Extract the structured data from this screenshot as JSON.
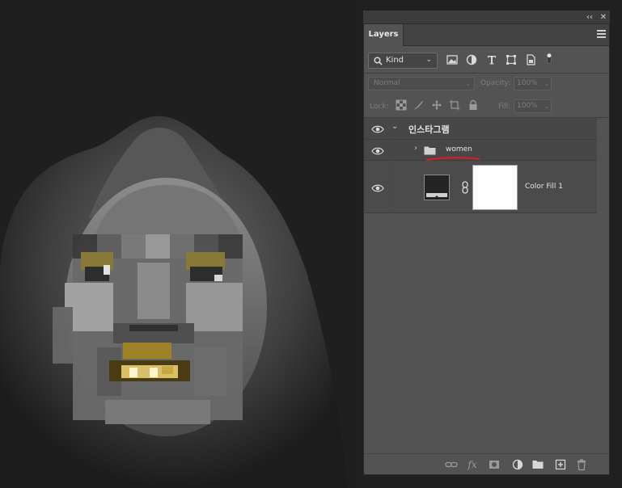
{
  "panel": {
    "tab_label": "Layers",
    "collapse_label": "‹‹",
    "close_label": "✕"
  },
  "filter": {
    "kind_label": "Kind"
  },
  "blend": {
    "mode": "Normal",
    "opacity_label": "Opacity:",
    "opacity_value": "100%",
    "lock_label": "Lock:",
    "fill_label": "Fill:",
    "fill_value": "100%"
  },
  "layers": [
    {
      "name": "인스타그램",
      "type": "group",
      "expanded": true,
      "visible": true
    },
    {
      "name": "women",
      "type": "group",
      "expanded": false,
      "visible": true,
      "underline_color": "#d21e2a"
    },
    {
      "name": "Color Fill 1",
      "type": "fill",
      "visible": true,
      "fill_color": "#242424",
      "mask_color": "#ffffff"
    }
  ],
  "colors": {
    "panel_bg": "#535353",
    "selected_row": "#4a4a4a",
    "annotation_red": "#d21e2a",
    "gold": "#b8952a"
  },
  "icons": [
    "collapse-icon",
    "close-icon",
    "menu-icon",
    "search-icon",
    "image-filter-icon",
    "adjustment-filter-icon",
    "type-filter-icon",
    "shape-filter-icon",
    "smart-object-filter-icon",
    "filter-toggle-icon",
    "lock-pixels-icon",
    "lock-image-icon",
    "lock-position-icon",
    "lock-artboard-icon",
    "lock-all-icon",
    "link-icon",
    "fx-icon",
    "mask-icon",
    "adjustment-icon",
    "folder-icon",
    "new-layer-icon",
    "trash-icon"
  ]
}
